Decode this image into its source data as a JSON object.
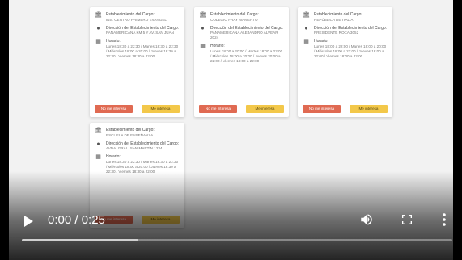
{
  "cards": [
    {
      "establishment_label": "Establecimiento del Cargo:",
      "establishment_value": "INS. CENTRO PRIMERO EVANGELI",
      "address_label": "Dirección del Establecimiento del Cargo:",
      "address_value": "PANAMERICANA KM 5 Y AV. SAN JUAN",
      "schedule_label": "Horario:",
      "schedule_value": "Lunes 18:30 a 22:30 / Martes 18:30 a 22:30 / Miércoles 18:00 a 20:00 / Jueves 18:30 a 22:30 / Viernes 18:30 a 22:00",
      "no_label": "No me interesa",
      "yes_label": "Me interesa"
    },
    {
      "establishment_label": "Establecimiento del Cargo:",
      "establishment_value": "COLEGIO FRAY MAMERTO",
      "address_label": "Dirección del Establecimiento del Cargo:",
      "address_value": "PANAMERICANA ALEJANDRO ALVEAR 2024",
      "schedule_label": "Horario:",
      "schedule_value": "Lunes 18:00 a 20:00 / Martes 18:00 a 22:00 / Miércoles 18:00 a 20:00 / Jueves 20:00 a 22:00 / Viernes 18:00 a 22:00",
      "no_label": "No me interesa",
      "yes_label": "Me interesa"
    },
    {
      "establishment_label": "Establecimiento del Cargo:",
      "establishment_value": "REPÚBLICA DE ITALIA",
      "address_label": "Dirección del Establecimiento del Cargo:",
      "address_value": "PRESIDENTE ROCA 3052",
      "schedule_label": "Horario:",
      "schedule_value": "Lunes 18:00 a 22:00 / Martes 18:00 a 20:00 / Miércoles 18:00 a 22:00 / Jueves 18:00 a 22:00 / Viernes 18:00 a 22:00",
      "no_label": "No me interesa",
      "yes_label": "Me interesa"
    },
    {
      "establishment_label": "Establecimiento del Cargo:",
      "establishment_value": "ESCUELA DE ENSEÑANZA",
      "address_label": "Dirección del Establecimiento del Cargo:",
      "address_value": "AVDA. GRAL. SAN MARTÍN 1234",
      "schedule_label": "Horario:",
      "schedule_value": "Lunes 18:30 a 22:30 / Martes 18:30 a 22:30 / Miércoles 18:00 a 20:00 / Jueves 18:30 a 22:30 / Viernes 18:30 a 22:00",
      "no_label": "No me interesa",
      "yes_label": "Me interesa"
    }
  ],
  "player": {
    "time": "0:00 / 0:25",
    "progress_fraction": 0.27,
    "play_icon": "play-icon",
    "volume_icon": "volume-icon",
    "fullscreen_icon": "fullscreen-icon",
    "more_icon": "more-options-icon"
  }
}
